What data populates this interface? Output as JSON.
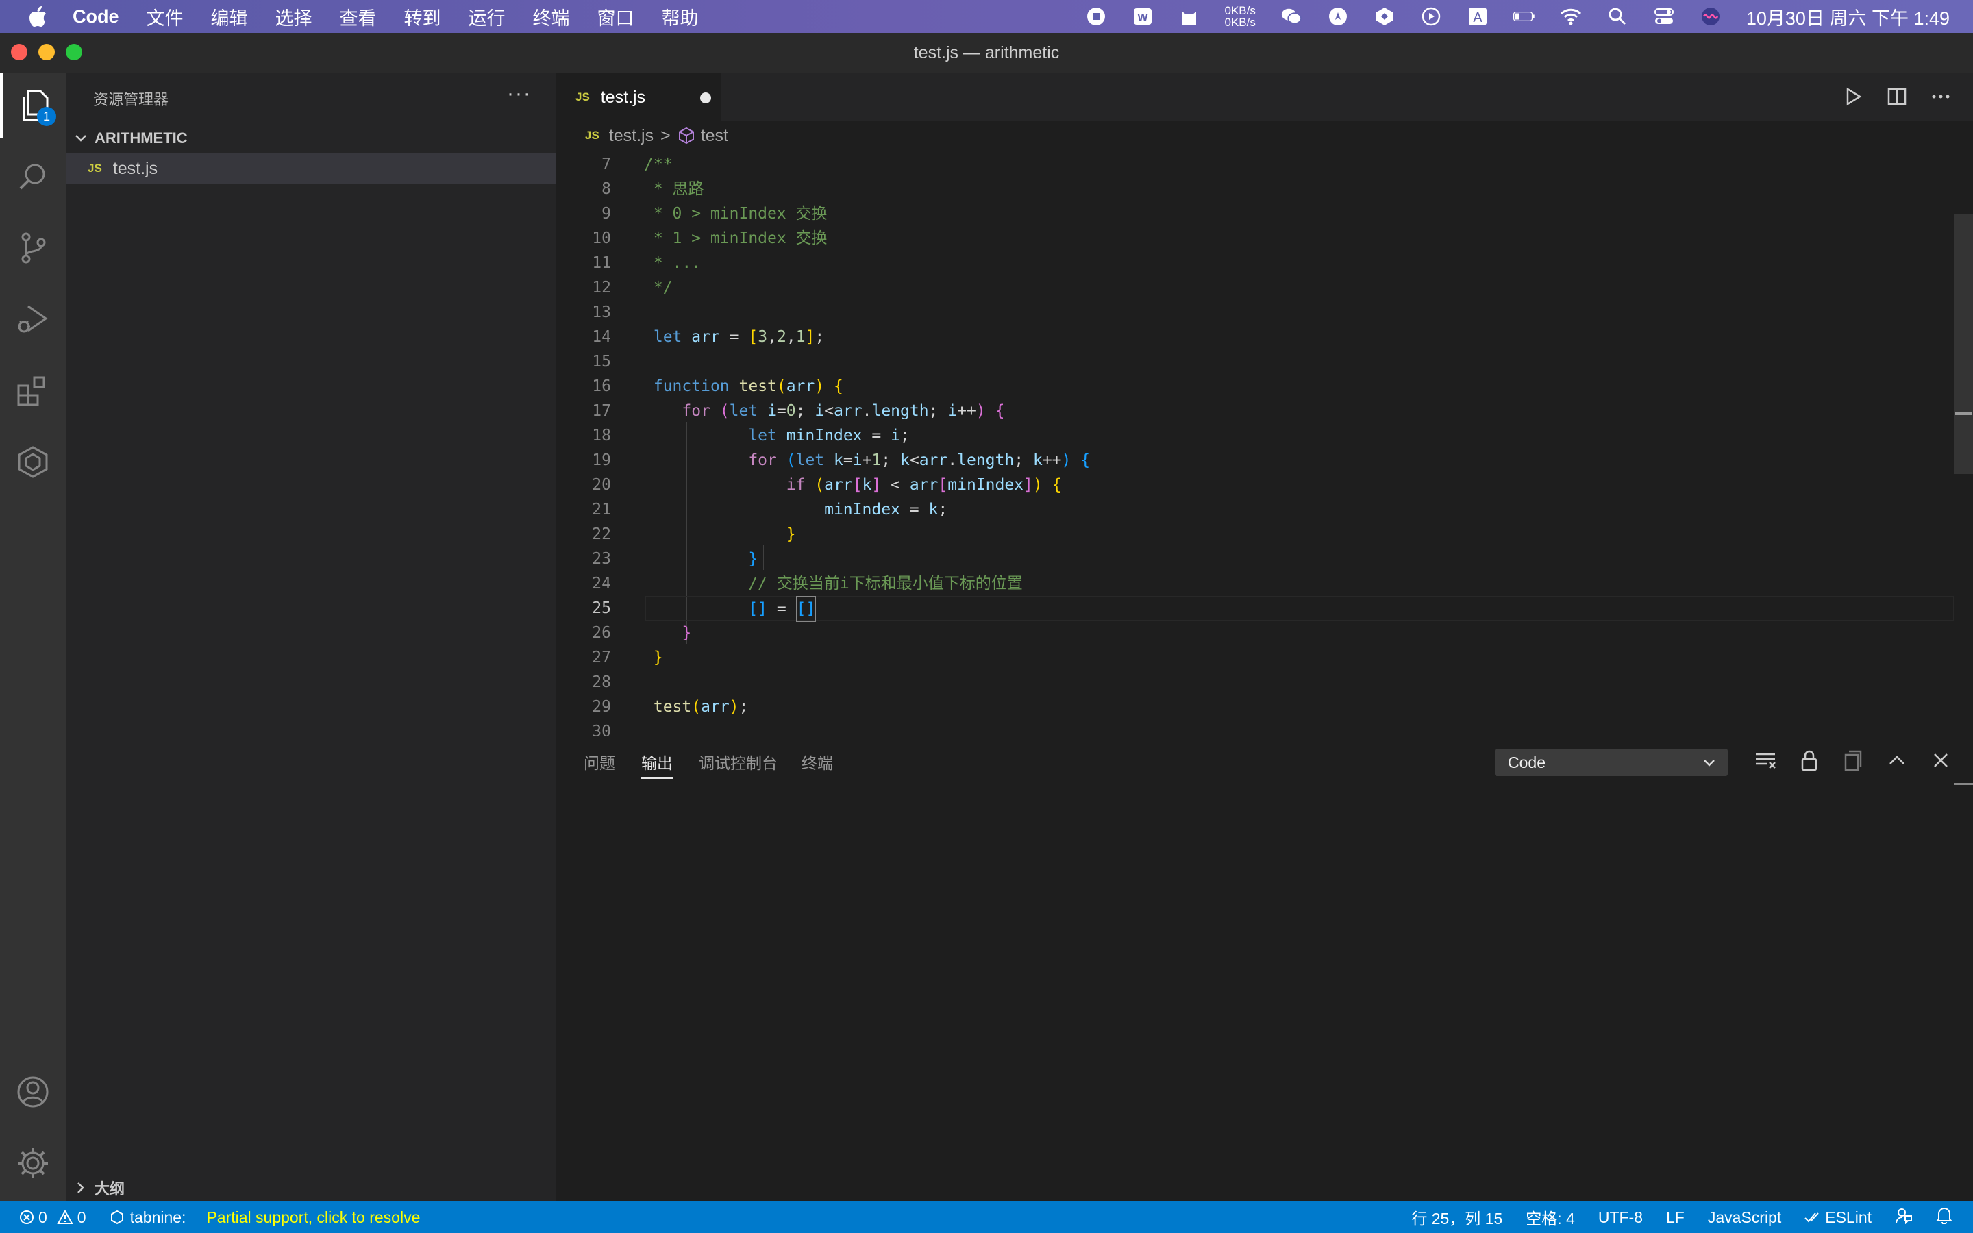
{
  "menubar": {
    "app_name": "Code",
    "menus": [
      "文件",
      "编辑",
      "选择",
      "查看",
      "转到",
      "运行",
      "终端",
      "窗口",
      "帮助"
    ],
    "net_up": "0KB/s",
    "net_down": "0KB/s",
    "clock": "10月30日 周六 下午 1:49"
  },
  "window": {
    "title": "test.js — arithmetic"
  },
  "activity_bar": {
    "explorer_badge": "1"
  },
  "sidebar": {
    "header": "资源管理器",
    "more": "···",
    "folder": "ARITHMETIC",
    "files": [
      {
        "badge": "JS",
        "name": "test.js"
      }
    ],
    "outline": "大纲"
  },
  "editor": {
    "tab": {
      "badge": "JS",
      "name": "test.js"
    },
    "breadcrumb": {
      "badge": "JS",
      "file": "test.js",
      "separator": ">",
      "symbol": "test"
    },
    "current_line": 25
  },
  "panel": {
    "tabs": [
      "问题",
      "输出",
      "调试控制台",
      "终端"
    ],
    "active_tab": "输出",
    "output_channel": "Code"
  },
  "statusbar": {
    "errors": "0",
    "warnings": "0",
    "tabnine": "tabnine:",
    "tabnine_message": "Partial support, click to resolve",
    "position": "行 25，列 15",
    "indent": "空格: 4",
    "encoding": "UTF-8",
    "eol": "LF",
    "language": "JavaScript",
    "eslint": "ESLint"
  },
  "colors": {
    "accent": "#007acc",
    "comment": "#6a9955",
    "keyword": "#569cd6",
    "control": "#c586c0",
    "variable": "#9cdcfe",
    "function": "#dcdcaa",
    "number": "#b5cea8",
    "tabnine_warning": "#ffff00"
  }
}
